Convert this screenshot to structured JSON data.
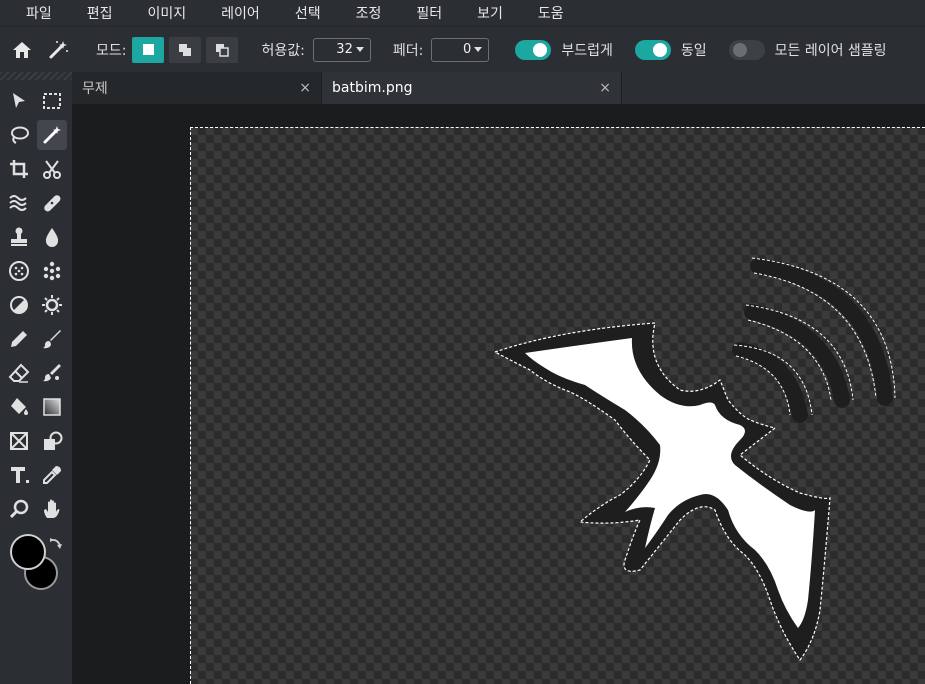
{
  "menu": [
    "파일",
    "편집",
    "이미지",
    "레이어",
    "선택",
    "조정",
    "필터",
    "보기",
    "도움"
  ],
  "options": {
    "mode_label": "모드:",
    "tolerance_label": "허용값:",
    "tolerance_value": "32",
    "feather_label": "페더:",
    "feather_value": "0",
    "smooth_label": "부드럽게",
    "smooth_on": true,
    "contiguous_label": "동일",
    "contiguous_on": true,
    "sample_all_label": "모든 레이어 샘플링",
    "sample_all_on": false
  },
  "tabs": [
    {
      "label": "무제",
      "close": "×"
    },
    {
      "label": "batbim.png",
      "close": "×"
    }
  ],
  "colors": {
    "accent": "#1ca7a1",
    "foreground": "#000000",
    "background": "#000000"
  },
  "tools": [
    "move-icon",
    "marquee-icon",
    "lasso-icon",
    "magic-wand-icon",
    "crop-icon",
    "scissors-icon",
    "liquify-icon",
    "heal-icon",
    "stamp-icon",
    "blur-icon",
    "sponge-icon",
    "pixelate-icon",
    "dodge-icon",
    "sharpen-icon",
    "pen-icon",
    "brush-icon",
    "eraser-icon",
    "color-replace-icon",
    "fill-icon",
    "gradient-icon",
    "frame-icon",
    "shape-icon",
    "text-icon",
    "eyedropper-icon",
    "zoom-icon",
    "hand-icon"
  ]
}
